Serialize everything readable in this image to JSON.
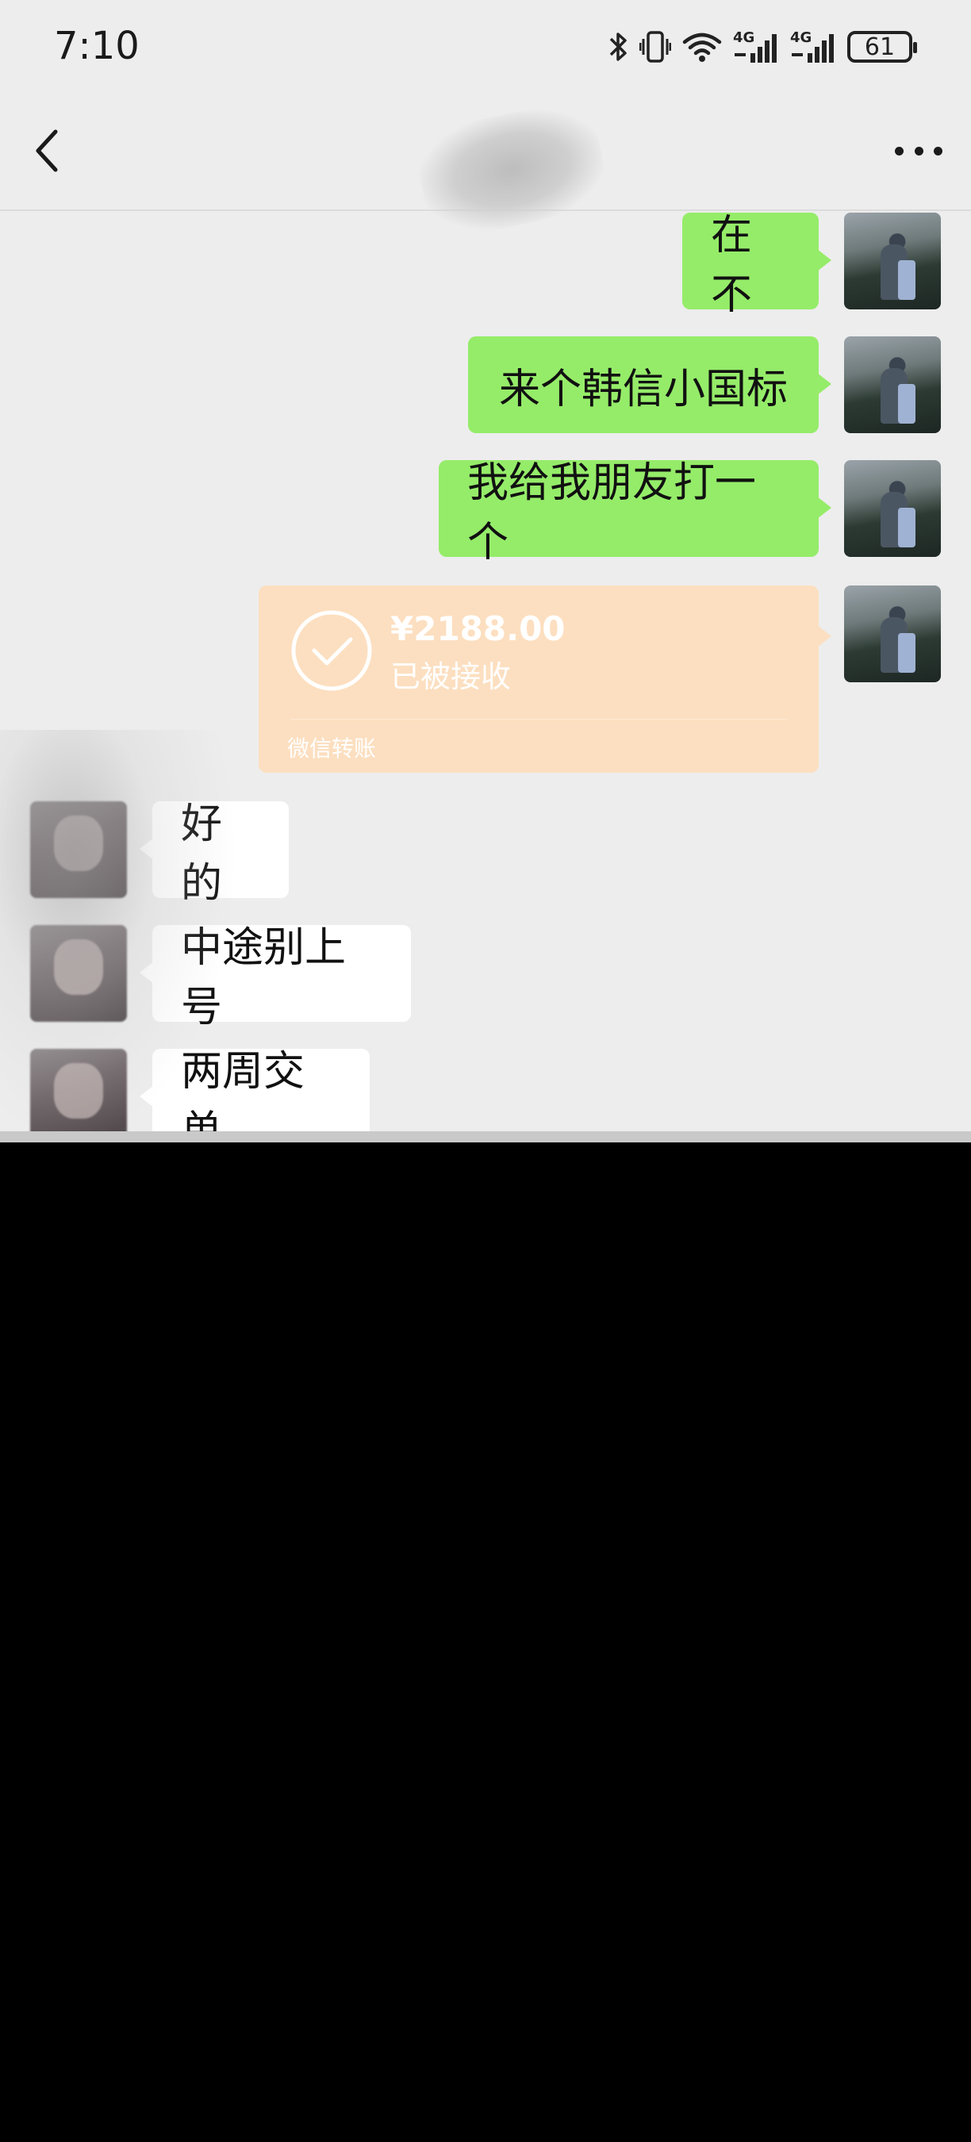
{
  "status_bar": {
    "time": "7:10",
    "battery": "61",
    "network_1": "4G",
    "network_2": "4G",
    "icons": [
      "bluetooth-icon",
      "vibrate-icon",
      "wifi-icon",
      "signal-icon",
      "signal-icon",
      "battery-icon"
    ]
  },
  "nav": {
    "back_icon": "chevron-left-icon",
    "title": "",
    "more_icon": "more-dots-icon"
  },
  "messages": [
    {
      "sender": "me",
      "text": "在不"
    },
    {
      "sender": "me",
      "text": "来个韩信小国标"
    },
    {
      "sender": "me",
      "text": "我给我朋友打一个"
    },
    {
      "sender": "me",
      "type": "transfer",
      "amount": "¥2188.00",
      "status": "已被接收",
      "footer": "微信转账"
    },
    {
      "sender": "other",
      "text": "好的"
    },
    {
      "sender": "other",
      "text": "中途别上号"
    },
    {
      "sender": "other",
      "text": "两周交单"
    }
  ],
  "colors": {
    "screen_bg": "#ededed",
    "my_bubble": "#95ec69",
    "other_bubble": "#ffffff",
    "transfer_card": "#fcdfc0",
    "below_screen": "#000000"
  }
}
